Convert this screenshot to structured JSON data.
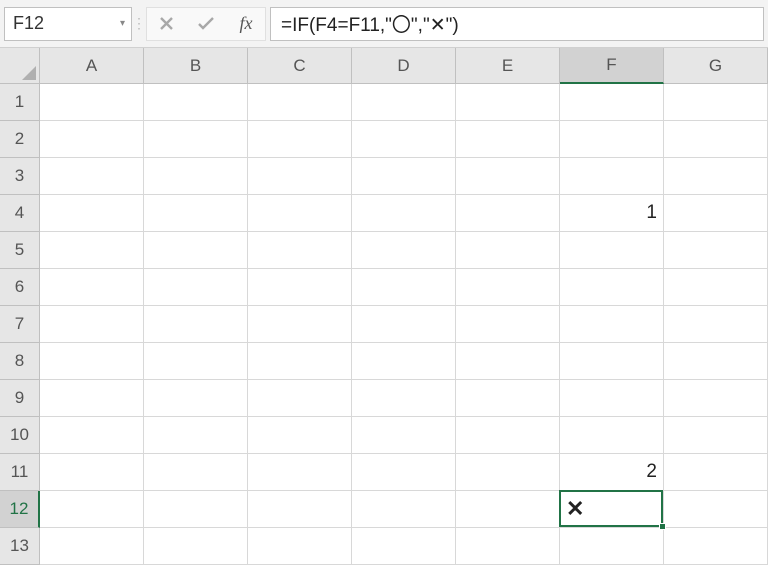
{
  "nameBox": {
    "value": "F12"
  },
  "formulaBar": {
    "content": "=IF(F4=F11,\"〇\",\"✕\")"
  },
  "columns": [
    "A",
    "B",
    "C",
    "D",
    "E",
    "F",
    "G"
  ],
  "rows": [
    "1",
    "2",
    "3",
    "4",
    "5",
    "6",
    "7",
    "8",
    "9",
    "10",
    "11",
    "12",
    "13"
  ],
  "selectedColumn": "F",
  "selectedRow": "12",
  "cells": {
    "F4": "1",
    "F11": "2",
    "F12": "✕"
  },
  "icons": {
    "cancel": "✕",
    "enter": "✓",
    "fx": "fx",
    "dropdown": "▾"
  }
}
